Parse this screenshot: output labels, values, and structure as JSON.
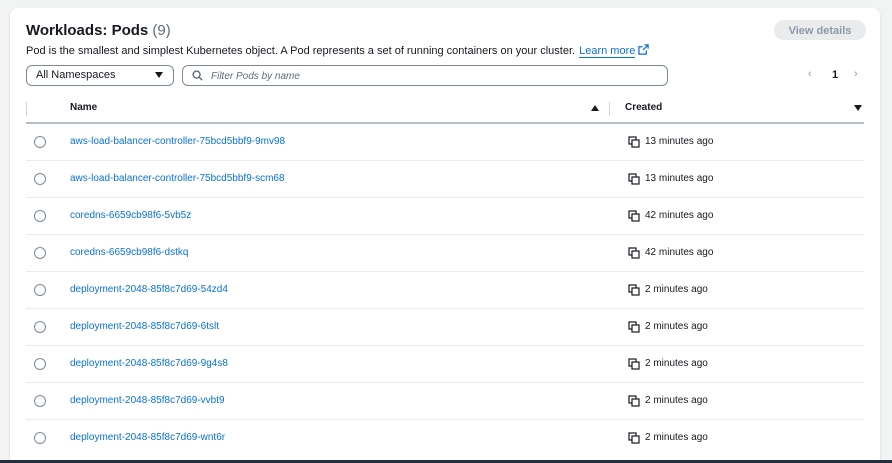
{
  "header": {
    "title": "Workloads: Pods",
    "count": "(9)",
    "description": "Pod is the smallest and simplest Kubernetes object. A Pod represents a set of running containers on your cluster.",
    "learn_more": "Learn more",
    "view_details": "View details"
  },
  "filters": {
    "namespace": "All Namespaces",
    "search_placeholder": "Filter Pods by name"
  },
  "pagination": {
    "current_page": "1",
    "prev": "‹",
    "next": "›"
  },
  "table": {
    "columns": {
      "name": "Name",
      "created": "Created"
    },
    "rows": [
      {
        "name": "aws-load-balancer-controller-75bcd5bbf9-9mv98",
        "created": "13 minutes ago"
      },
      {
        "name": "aws-load-balancer-controller-75bcd5bbf9-scm68",
        "created": "13 minutes ago"
      },
      {
        "name": "coredns-6659cb98f6-5vb5z",
        "created": "42 minutes ago"
      },
      {
        "name": "coredns-6659cb98f6-dstkq",
        "created": "42 minutes ago"
      },
      {
        "name": "deployment-2048-85f8c7d69-54zd4",
        "created": "2 minutes ago"
      },
      {
        "name": "deployment-2048-85f8c7d69-6tslt",
        "created": "2 minutes ago"
      },
      {
        "name": "deployment-2048-85f8c7d69-9g4s8",
        "created": "2 minutes ago"
      },
      {
        "name": "deployment-2048-85f8c7d69-vvbt9",
        "created": "2 minutes ago"
      },
      {
        "name": "deployment-2048-85f8c7d69-wnt6r",
        "created": "2 minutes ago"
      }
    ]
  },
  "icons": {
    "external_link": "external-link-icon",
    "search": "search-icon",
    "copy": "copy-icon",
    "dropdown": "caret-down-icon"
  },
  "colors": {
    "link": "#0972d3",
    "text": "#16191f",
    "muted": "#5f6b7a",
    "disabled_bg": "#e9ebed"
  }
}
